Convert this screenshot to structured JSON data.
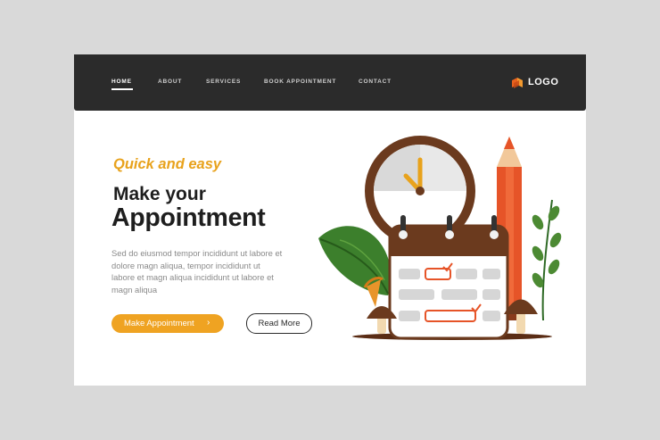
{
  "nav": {
    "items": [
      {
        "label": "HOME",
        "active": true
      },
      {
        "label": "ABOUT"
      },
      {
        "label": "SERVICES"
      },
      {
        "label": "BOOK APPOINTMENT"
      },
      {
        "label": "CONTACT"
      }
    ],
    "logo_text": "LOGO"
  },
  "hero": {
    "tagline": "Quick and easy",
    "headline_line1": "Make your",
    "headline_line2": "Appointment",
    "body_lines": [
      "Sed do eiusmod tempor incididunt ut labore et",
      "dolore magn aliqua, tempor incididunt ut",
      "labore et  magn aliqua incididunt ut labore et",
      "magn aliqua"
    ],
    "primary_button": "Make Appointment",
    "primary_button_chevron": "›",
    "secondary_button": "Read More"
  },
  "colors": {
    "navbar": "#2b2b2b",
    "accent": "#efa322",
    "logo_orange": "#e8621e",
    "headline": "#1e1e1e",
    "body_text": "#8a8a8a"
  },
  "illustration": {
    "icons": [
      "clock-icon",
      "calendar-icon",
      "pencil-icon",
      "leaf-icon",
      "mushroom-icon"
    ]
  }
}
